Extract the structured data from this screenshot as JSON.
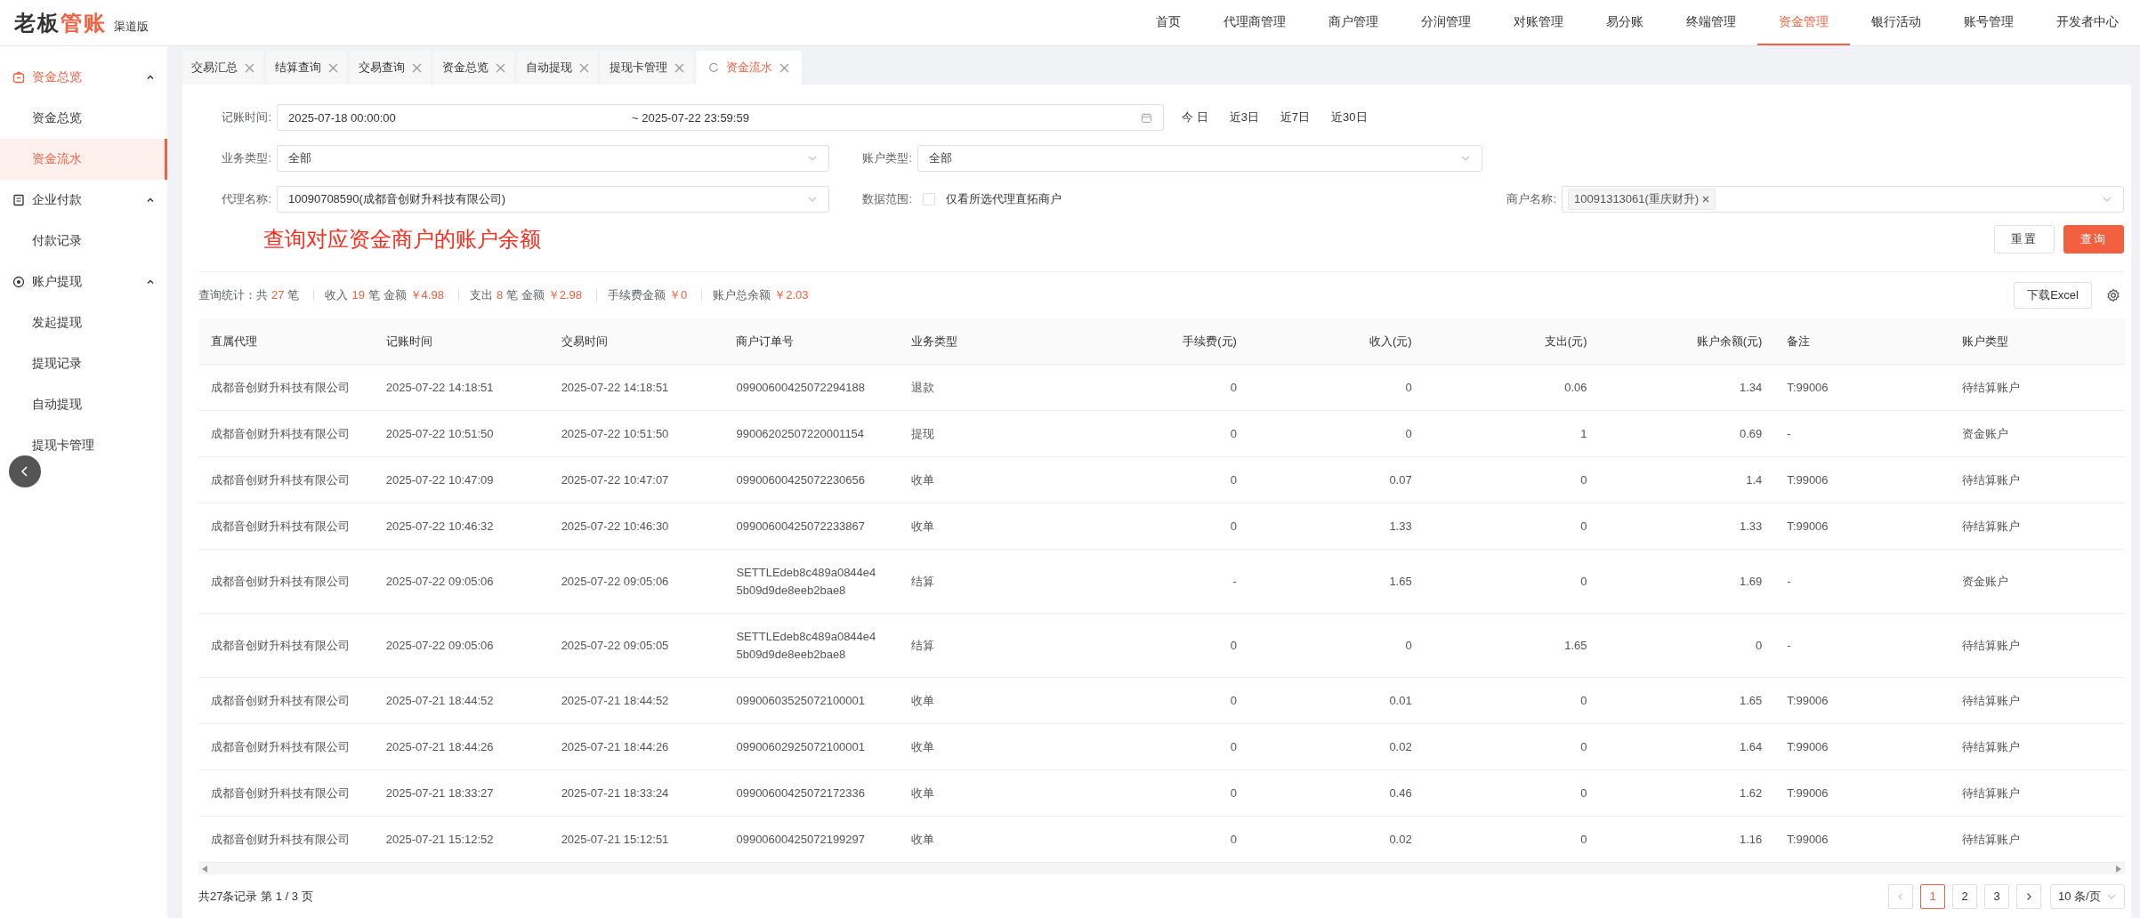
{
  "header": {
    "logo": {
      "main": "老板",
      "accent": "管账"
    },
    "edition": "渠道版",
    "nav": [
      {
        "label": "首页",
        "selected": false
      },
      {
        "label": "代理商管理",
        "selected": false
      },
      {
        "label": "商户管理",
        "selected": false
      },
      {
        "label": "分润管理",
        "selected": false
      },
      {
        "label": "对账管理",
        "selected": false
      },
      {
        "label": "易分账",
        "selected": false
      },
      {
        "label": "终端管理",
        "selected": false
      },
      {
        "label": "资金管理",
        "selected": true
      },
      {
        "label": "银行活动",
        "selected": false
      },
      {
        "label": "账号管理",
        "selected": false
      },
      {
        "label": "开发者中心",
        "selected": false
      }
    ]
  },
  "sidebar": {
    "groups": [
      {
        "label": "资金总览",
        "expanded": true,
        "selected": true,
        "items": [
          {
            "label": "资金总览",
            "selected": false
          },
          {
            "label": "资金流水",
            "selected": true
          }
        ]
      },
      {
        "label": "企业付款",
        "expanded": true,
        "selected": false,
        "items": [
          {
            "label": "付款记录",
            "selected": false
          }
        ]
      },
      {
        "label": "账户提现",
        "expanded": true,
        "selected": false,
        "items": [
          {
            "label": "发起提现",
            "selected": false
          },
          {
            "label": "提现记录",
            "selected": false
          },
          {
            "label": "自动提现",
            "selected": false
          },
          {
            "label": "提现卡管理",
            "selected": false
          }
        ]
      }
    ]
  },
  "tabs": [
    {
      "label": "交易汇总",
      "selected": false
    },
    {
      "label": "结算查询",
      "selected": false
    },
    {
      "label": "交易查询",
      "selected": false
    },
    {
      "label": "资金总览",
      "selected": false
    },
    {
      "label": "自动提现",
      "selected": false
    },
    {
      "label": "提现卡管理",
      "selected": false
    },
    {
      "label": "资金流水",
      "selected": true
    }
  ],
  "filters": {
    "date": {
      "label": "记账时间:",
      "start": "2025-07-18 00:00:00",
      "end": "~ 2025-07-22 23:59:59"
    },
    "quick_ranges": [
      "今 日",
      "近3日",
      "近7日",
      "近30日"
    ],
    "business_type": {
      "label": "业务类型:",
      "value": "全部"
    },
    "account_type": {
      "label": "账户类型:",
      "value": "全部"
    },
    "agent": {
      "label": "代理名称:",
      "value": "10090708590(成都音创财升科技有限公司)"
    },
    "scope": {
      "label": "数据范围:",
      "option": "仅看所选代理直拓商户",
      "checked": false
    },
    "merchant": {
      "label": "商户名称:",
      "tags": [
        "10091313061(重庆财升)"
      ]
    }
  },
  "annotation": "查询对应资金商户的账户余额",
  "buttons": {
    "reset": "重置",
    "query": "查询"
  },
  "stats": [
    [
      {
        "text": "查询统计：共",
        "highlight": false
      },
      {
        "text": "27",
        "highlight": true
      },
      {
        "text": "笔",
        "highlight": false
      }
    ],
    [
      {
        "text": "收入",
        "highlight": false
      },
      {
        "text": "19",
        "highlight": true
      },
      {
        "text": "笔 金额",
        "highlight": false
      },
      {
        "text": "￥4.98",
        "highlight": true
      }
    ],
    [
      {
        "text": "支出",
        "highlight": false
      },
      {
        "text": "8",
        "highlight": true
      },
      {
        "text": "笔 金额",
        "highlight": false
      },
      {
        "text": "￥2.98",
        "highlight": true
      }
    ],
    [
      {
        "text": "手续费金额",
        "highlight": false
      },
      {
        "text": "￥0",
        "highlight": true
      }
    ],
    [
      {
        "text": "账户总余额",
        "highlight": false
      },
      {
        "text": "￥2.03",
        "highlight": true
      }
    ]
  ],
  "download": "下载Excel",
  "table": {
    "columns": [
      {
        "label": "直属代理",
        "kind": "text"
      },
      {
        "label": "记账时间",
        "kind": "text"
      },
      {
        "label": "交易时间",
        "kind": "text"
      },
      {
        "label": "商户订单号",
        "kind": "text"
      },
      {
        "label": "业务类型",
        "kind": "text"
      },
      {
        "label": "手续费(元)",
        "kind": "amount"
      },
      {
        "label": "收入(元)",
        "kind": "amount"
      },
      {
        "label": "支出(元)",
        "kind": "amount"
      },
      {
        "label": "账户余额(元)",
        "kind": "amount"
      },
      {
        "label": "备注",
        "kind": "text"
      },
      {
        "label": "账户类型",
        "kind": "text"
      }
    ],
    "rows": [
      [
        "成都音创财升科技有限公司",
        "2025-07-22 14:18:51",
        "2025-07-22 14:18:51",
        "09900600425072294188",
        "退款",
        "0",
        "0",
        "0.06",
        "1.34",
        "T:99006",
        "待结算账户"
      ],
      [
        "成都音创财升科技有限公司",
        "2025-07-22 10:51:50",
        "2025-07-22 10:51:50",
        "99006202507220001154",
        "提现",
        "0",
        "0",
        "1",
        "0.69",
        "-",
        "资金账户"
      ],
      [
        "成都音创财升科技有限公司",
        "2025-07-22 10:47:09",
        "2025-07-22 10:47:07",
        "09900600425072230656",
        "收单",
        "0",
        "0.07",
        "0",
        "1.4",
        "T:99006",
        "待结算账户"
      ],
      [
        "成都音创财升科技有限公司",
        "2025-07-22 10:46:32",
        "2025-07-22 10:46:30",
        "09900600425072233867",
        "收单",
        "0",
        "1.33",
        "0",
        "1.33",
        "T:99006",
        "待结算账户"
      ],
      [
        "成都音创财升科技有限公司",
        "2025-07-22 09:05:06",
        "2025-07-22 09:05:06",
        "SETTLEdeb8c489a0844e45b09d9de8eeb2bae8",
        "结算",
        "-",
        "1.65",
        "0",
        "1.69",
        "-",
        "资金账户"
      ],
      [
        "成都音创财升科技有限公司",
        "2025-07-22 09:05:06",
        "2025-07-22 09:05:05",
        "SETTLEdeb8c489a0844e45b09d9de8eeb2bae8",
        "结算",
        "0",
        "0",
        "1.65",
        "0",
        "-",
        "待结算账户"
      ],
      [
        "成都音创财升科技有限公司",
        "2025-07-21 18:44:52",
        "2025-07-21 18:44:52",
        "09900603525072100001",
        "收单",
        "0",
        "0.01",
        "0",
        "1.65",
        "T:99006",
        "待结算账户"
      ],
      [
        "成都音创财升科技有限公司",
        "2025-07-21 18:44:26",
        "2025-07-21 18:44:26",
        "09900602925072100001",
        "收单",
        "0",
        "0.02",
        "0",
        "1.64",
        "T:99006",
        "待结算账户"
      ],
      [
        "成都音创财升科技有限公司",
        "2025-07-21 18:33:27",
        "2025-07-21 18:33:24",
        "09900600425072172336",
        "收单",
        "0",
        "0.46",
        "0",
        "1.62",
        "T:99006",
        "待结算账户"
      ],
      [
        "成都音创财升科技有限公司",
        "2025-07-21 15:12:52",
        "2025-07-21 15:12:51",
        "09900600425072199297",
        "收单",
        "0",
        "0.02",
        "0",
        "1.16",
        "T:99006",
        "待结算账户"
      ]
    ]
  },
  "pagination": {
    "summary": "共27条记录 第 1 / 3 页",
    "pages": [
      {
        "label": "1",
        "selected": true
      },
      {
        "label": "2",
        "selected": false
      },
      {
        "label": "3",
        "selected": false
      }
    ],
    "page_size": "10 条/页"
  }
}
